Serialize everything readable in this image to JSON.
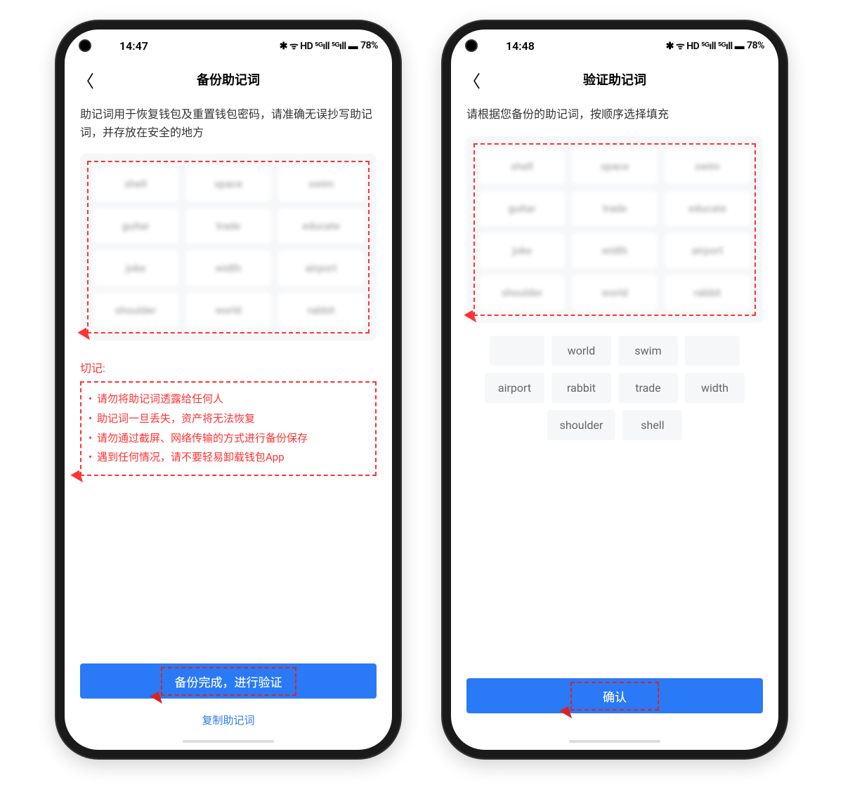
{
  "phone1": {
    "status": {
      "time": "14:47",
      "battery": "78%",
      "icons": "✱ ᯤ HD ⁵ᴳıll ⁵ᴳıll ▬"
    },
    "nav": {
      "title": "备份助记词"
    },
    "description": "助记词用于恢复钱包及重置钱包密码，请准确无误抄写助记词，并存放在安全的地方",
    "mnemonic": [
      "shell",
      "space",
      "swim",
      "guitar",
      "trade",
      "educate",
      "joke",
      "width",
      "airport",
      "shoulder",
      "world",
      "rabbit"
    ],
    "warning": {
      "title": "切记:",
      "items": [
        "请勿将助记词透露给任何人",
        "助记词一旦丢失，资产将无法恢复",
        "请勿通过截屏、网络传输的方式进行备份保存",
        "遇到任何情况，请不要轻易卸载钱包App"
      ]
    },
    "primaryButton": "备份完成，进行验证",
    "linkButton": "复制助记词"
  },
  "phone2": {
    "status": {
      "time": "14:48",
      "battery": "78%",
      "icons": "✱ ᯤ HD ⁵ᴳıll ⁵ᴳıll ▬"
    },
    "nav": {
      "title": "验证助记词"
    },
    "description": "请根据您备份的助记词，按顺序选择填充",
    "mnemonic": [
      "shell",
      "space",
      "swim",
      "guitar",
      "trade",
      "educate",
      "joke",
      "width",
      "airport",
      "shoulder",
      "world",
      "rabbit"
    ],
    "choices": {
      "row1": [
        "",
        "world",
        "swim",
        ""
      ],
      "row2": [
        "airport",
        "rabbit",
        "trade",
        "width"
      ],
      "row3": [
        "shoulder",
        "shell"
      ]
    },
    "primaryButton": "确认"
  }
}
